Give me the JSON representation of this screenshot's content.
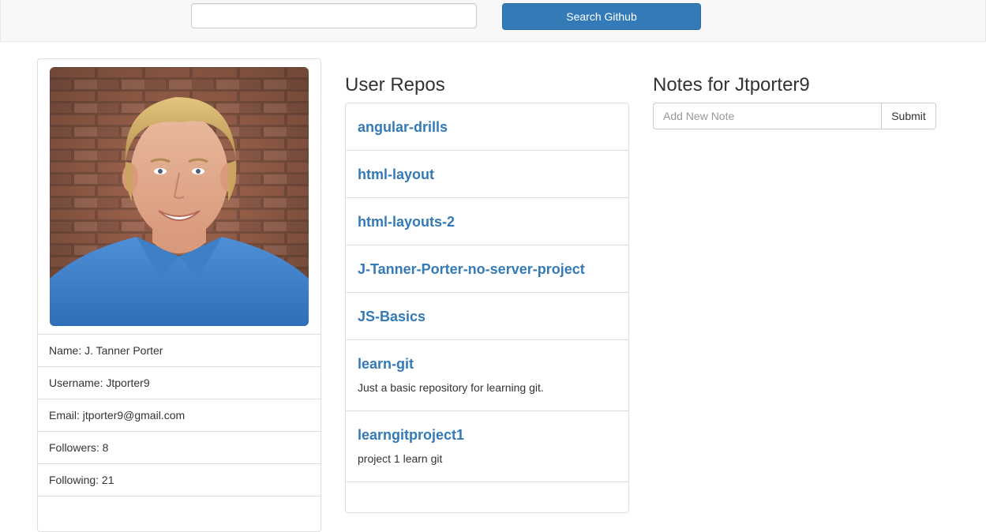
{
  "search": {
    "value": "",
    "placeholder": "",
    "button_label": "Search Github"
  },
  "profile": {
    "avatar_icon": "user-photo-avatar",
    "items": [
      {
        "label": "Name: J. Tanner Porter"
      },
      {
        "label": "Username: Jtporter9"
      },
      {
        "label": "Email: jtporter9@gmail.com"
      },
      {
        "label": "Followers: 8"
      },
      {
        "label": "Following: 21"
      }
    ]
  },
  "repos": {
    "heading": "User Repos",
    "items": [
      {
        "name": "angular-drills",
        "description": ""
      },
      {
        "name": "html-layout",
        "description": ""
      },
      {
        "name": "html-layouts-2",
        "description": ""
      },
      {
        "name": "J-Tanner-Porter-no-server-project",
        "description": ""
      },
      {
        "name": "JS-Basics",
        "description": ""
      },
      {
        "name": "learn-git",
        "description": "Just a basic repository for learning git."
      },
      {
        "name": "learngitproject1",
        "description": "project 1 learn git"
      }
    ]
  },
  "notes": {
    "heading": "Notes for Jtporter9",
    "input_placeholder": "Add New Note",
    "input_value": "",
    "submit_label": "Submit"
  },
  "colors": {
    "primary": "#337ab7",
    "link": "#337ab7",
    "navbar_bg": "#f8f8f8",
    "border": "#dddddd"
  }
}
